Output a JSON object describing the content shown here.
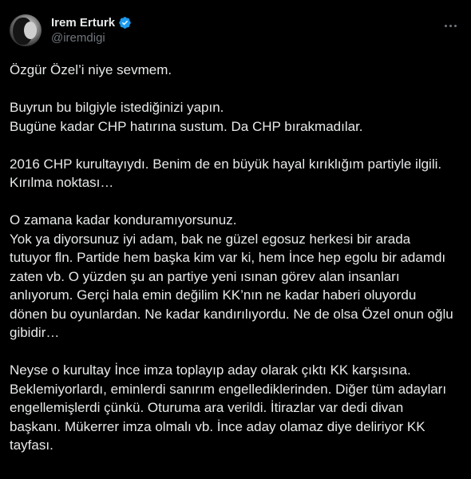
{
  "author": {
    "display_name": "Irem Erturk",
    "handle": "@iremdigi",
    "verified": true,
    "avatar_icon": "profile-photo",
    "verified_icon": "verified-badge-icon",
    "badge_color": "#1d9bf0"
  },
  "menu": {
    "icon": "more-options-icon"
  },
  "tweet": {
    "paragraphs": [
      [
        "Özgür Özel’i niye sevmem."
      ],
      [
        "Buyrun bu bilgiyle istediğinizi yapın.",
        "Bugüne kadar CHP hatırına sustum. Da CHP bırakmadılar."
      ],
      [
        "2016 CHP kurultayıydı. Benim de en büyük hayal kırıklığım partiyle ilgili.",
        "Kırılma noktası…"
      ],
      [
        "O zamana kadar konduramıyorsunuz.",
        "Yok ya diyorsunuz iyi adam, bak ne güzel egosuz herkesi bir arada",
        "tutuyor fln. Partide hem başka kim var ki, hem İnce hep egolu bir adamdı",
        "zaten vb. O yüzden şu an partiye yeni ısınan görev alan insanları",
        "anlıyorum. Gerçi hala emin değilim KK’nın ne kadar haberi oluyordu",
        "dönen bu oyunlardan. Ne kadar kandırılıyordu. Ne de olsa Özel onun oğlu",
        "gibidir…"
      ],
      [
        "Neyse o kurultay İnce imza toplayıp aday olarak çıktı KK karşısına.",
        "Beklemiyorlardı, eminlerdi sanırım engellediklerinden. Diğer tüm adayları",
        "engellemişlerdi çünkü. Oturuma ara verildi. İtirazlar var dedi divan",
        "başkanı. Mükerrer imza olmalı vb. İnce aday olamaz diye deliriyor KK",
        "tayfası."
      ]
    ]
  },
  "colors": {
    "background": "#000000",
    "text": "#e7e9ea",
    "secondary_text": "#71767b",
    "accent": "#1d9bf0"
  }
}
